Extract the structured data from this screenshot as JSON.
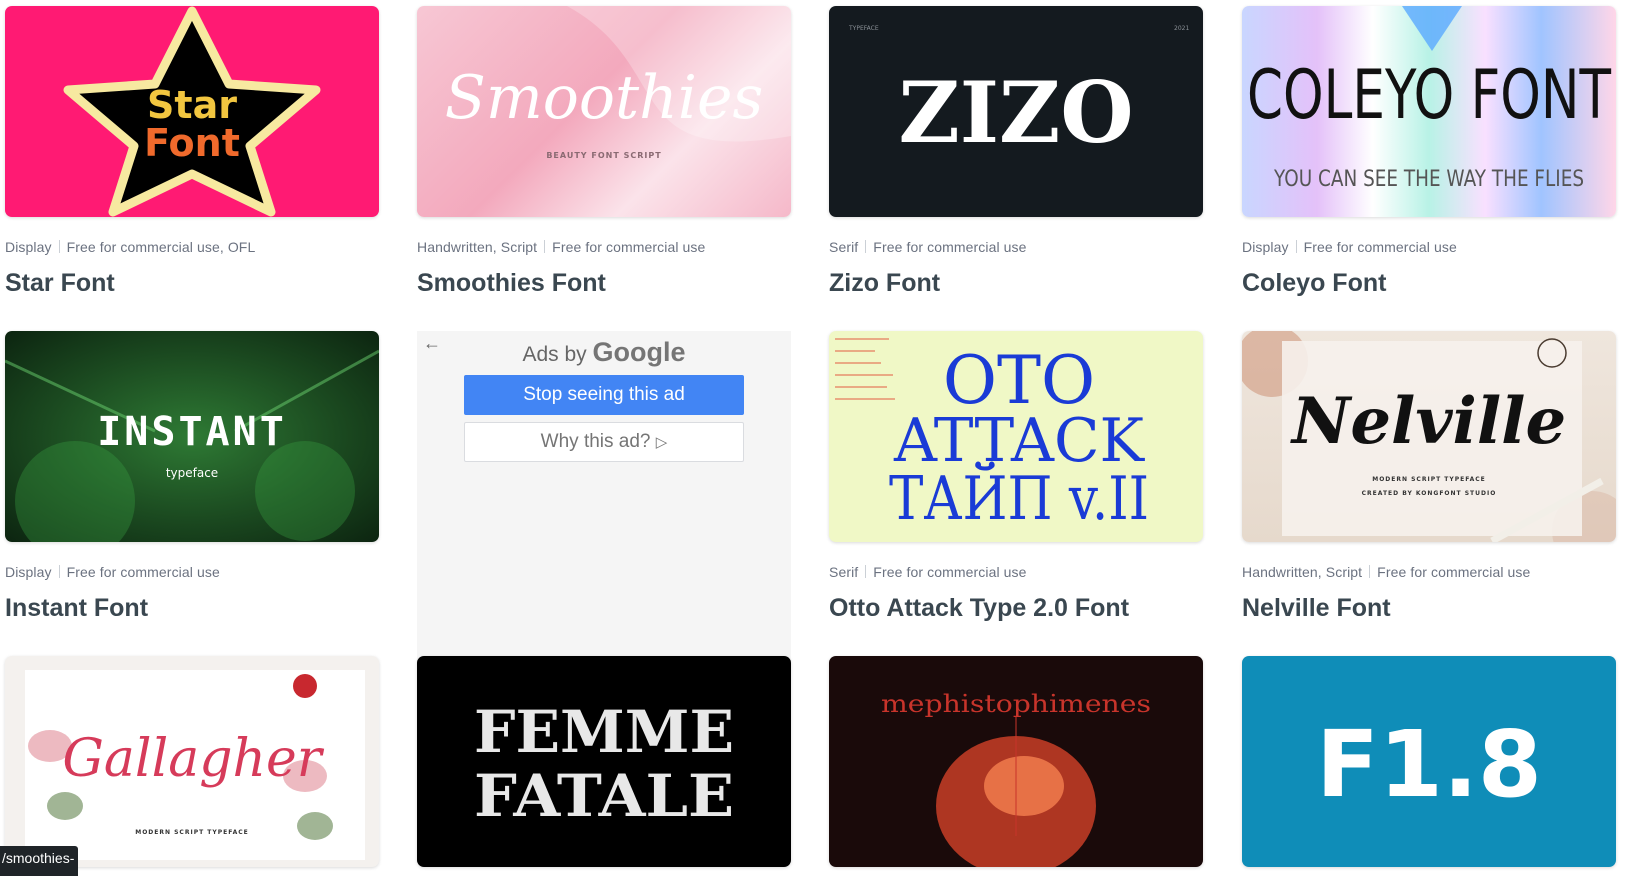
{
  "cards": [
    {
      "categories": "Display",
      "license": "Free for commercial use, OFL",
      "title": "Star Font",
      "art_text_1": "Star",
      "art_text_2": "Font"
    },
    {
      "categories": "Handwritten, Script",
      "license": "Free for commercial use",
      "title": "Smoothies Font",
      "art_text_1": "Smoothies",
      "art_text_2": "BEAUTY FONT SCRIPT"
    },
    {
      "categories": "Serif",
      "license": "Free for commercial use",
      "title": "Zizo Font",
      "art_text_1": "ZIZO",
      "art_text_2": "TYPEFACE",
      "art_text_3": "2021"
    },
    {
      "categories": "Display",
      "license": "Free for commercial use",
      "title": "Coleyo Font",
      "art_text_1": "COLEYO FONT",
      "art_text_2": "YOU CAN SEE THE WAY THE FLIES"
    },
    {
      "categories": "Display",
      "license": "Free for commercial use",
      "title": "Instant Font",
      "art_text_1": "INSTANT",
      "art_text_2": "typeface"
    },
    {
      "categories": "Serif",
      "license": "Free for commercial use",
      "title": "Otto Attack Type 2.0 Font",
      "art_text_1": "OTO",
      "art_text_2": "ATTACK",
      "art_text_3": "ТАЙП v.II"
    },
    {
      "categories": "Handwritten, Script",
      "license": "Free for commercial use",
      "title": "Nelville Font",
      "art_text_1": "Nelville",
      "art_text_2": "MODERN SCRIPT TYPEFACE",
      "art_text_3": "CREATED BY KONGFONT STUDIO"
    },
    {
      "art_text_1": "Gallagher",
      "art_text_2": "MODERN SCRIPT TYPEFACE"
    },
    {
      "art_text_1": "FEMME",
      "art_text_2": "FATALE"
    },
    {
      "art_text_1": "mephistophimenes"
    },
    {
      "art_text_1": "F1.8"
    }
  ],
  "ad": {
    "back_icon": "←",
    "ads_by": "Ads by",
    "google": "Google",
    "stop_label": "Stop seeing this ad",
    "why_label": "Why this ad?",
    "why_icon": "▷"
  },
  "status_bar": {
    "url": "/smoothies-"
  },
  "colors": {
    "star_bg": "#ff1a73",
    "zizo_bg": "#141a1f",
    "instant_bg": "#1b4a20",
    "otto_bg": "#f0f8c6",
    "otto_text": "#1a3bd6",
    "f18_bg": "#0f8db8",
    "ad_blue": "#4285f4",
    "title_text": "#3a4750"
  }
}
